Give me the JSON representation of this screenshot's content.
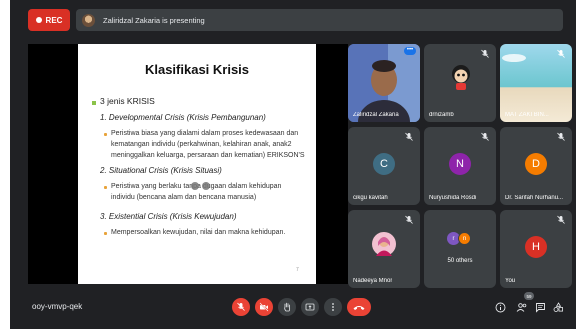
{
  "top_bar": {
    "rec_label": "REC",
    "presenting_text": "Zaliridzal Zakaria is presenting"
  },
  "slide": {
    "title": "Klasifikasi Krisis",
    "lines": [
      "3 jenis KRISIS",
      "1.  Developmental Crisis (Krisis Pembangunan)",
      "Peristiwa biasa yang dialami dalam proses kedewasaan dan",
      "kematangan individu (perkahwinan, kelahiran anak, anak2",
      "meninggalkan keluarga, persaraan dan kematian) ERIKSON'S",
      "2.  Situational Crisis (Krisis Situasi)",
      "Peristiwa yang berlaku tanpa dugaan dalam kehidupan",
      "individu (bencana alam dan bencana manusia)",
      "3.  Existential Crisis (Krisis Kewujudan)",
      "Mempersoalkan kewujudan, nilai dan makna kehidupan."
    ],
    "page_marker": "7"
  },
  "participants": [
    {
      "name": "Zaliridzal Zakaria",
      "initial": "",
      "color": ""
    },
    {
      "name": "drnizamb",
      "initial": "",
      "color": ""
    },
    {
      "name": "MAT ZAKI BIN...",
      "initial": "",
      "color": ""
    },
    {
      "name": "cikgu kavitah",
      "initial": "C",
      "color": "#3f6d83"
    },
    {
      "name": "Nuryushida Rosdi",
      "initial": "N",
      "color": "#8e24aa"
    },
    {
      "name": "Dr. Sarifah Nurhanu...",
      "initial": "D",
      "color": "#f57c00"
    },
    {
      "name": "Nadeeya Mnor",
      "initial": "",
      "color": ""
    },
    {
      "name": "50 others",
      "initial": "",
      "color": ""
    },
    {
      "name": "You",
      "initial": "H",
      "color": "#d93025"
    }
  ],
  "others_avatars": [
    "r",
    "n"
  ],
  "bottom_bar": {
    "meeting_code": "ooy-vmvp-qek",
    "participant_count": "59"
  },
  "colors": {
    "background": "#202124",
    "tile": "#3c4043",
    "danger": "#ea4335"
  }
}
